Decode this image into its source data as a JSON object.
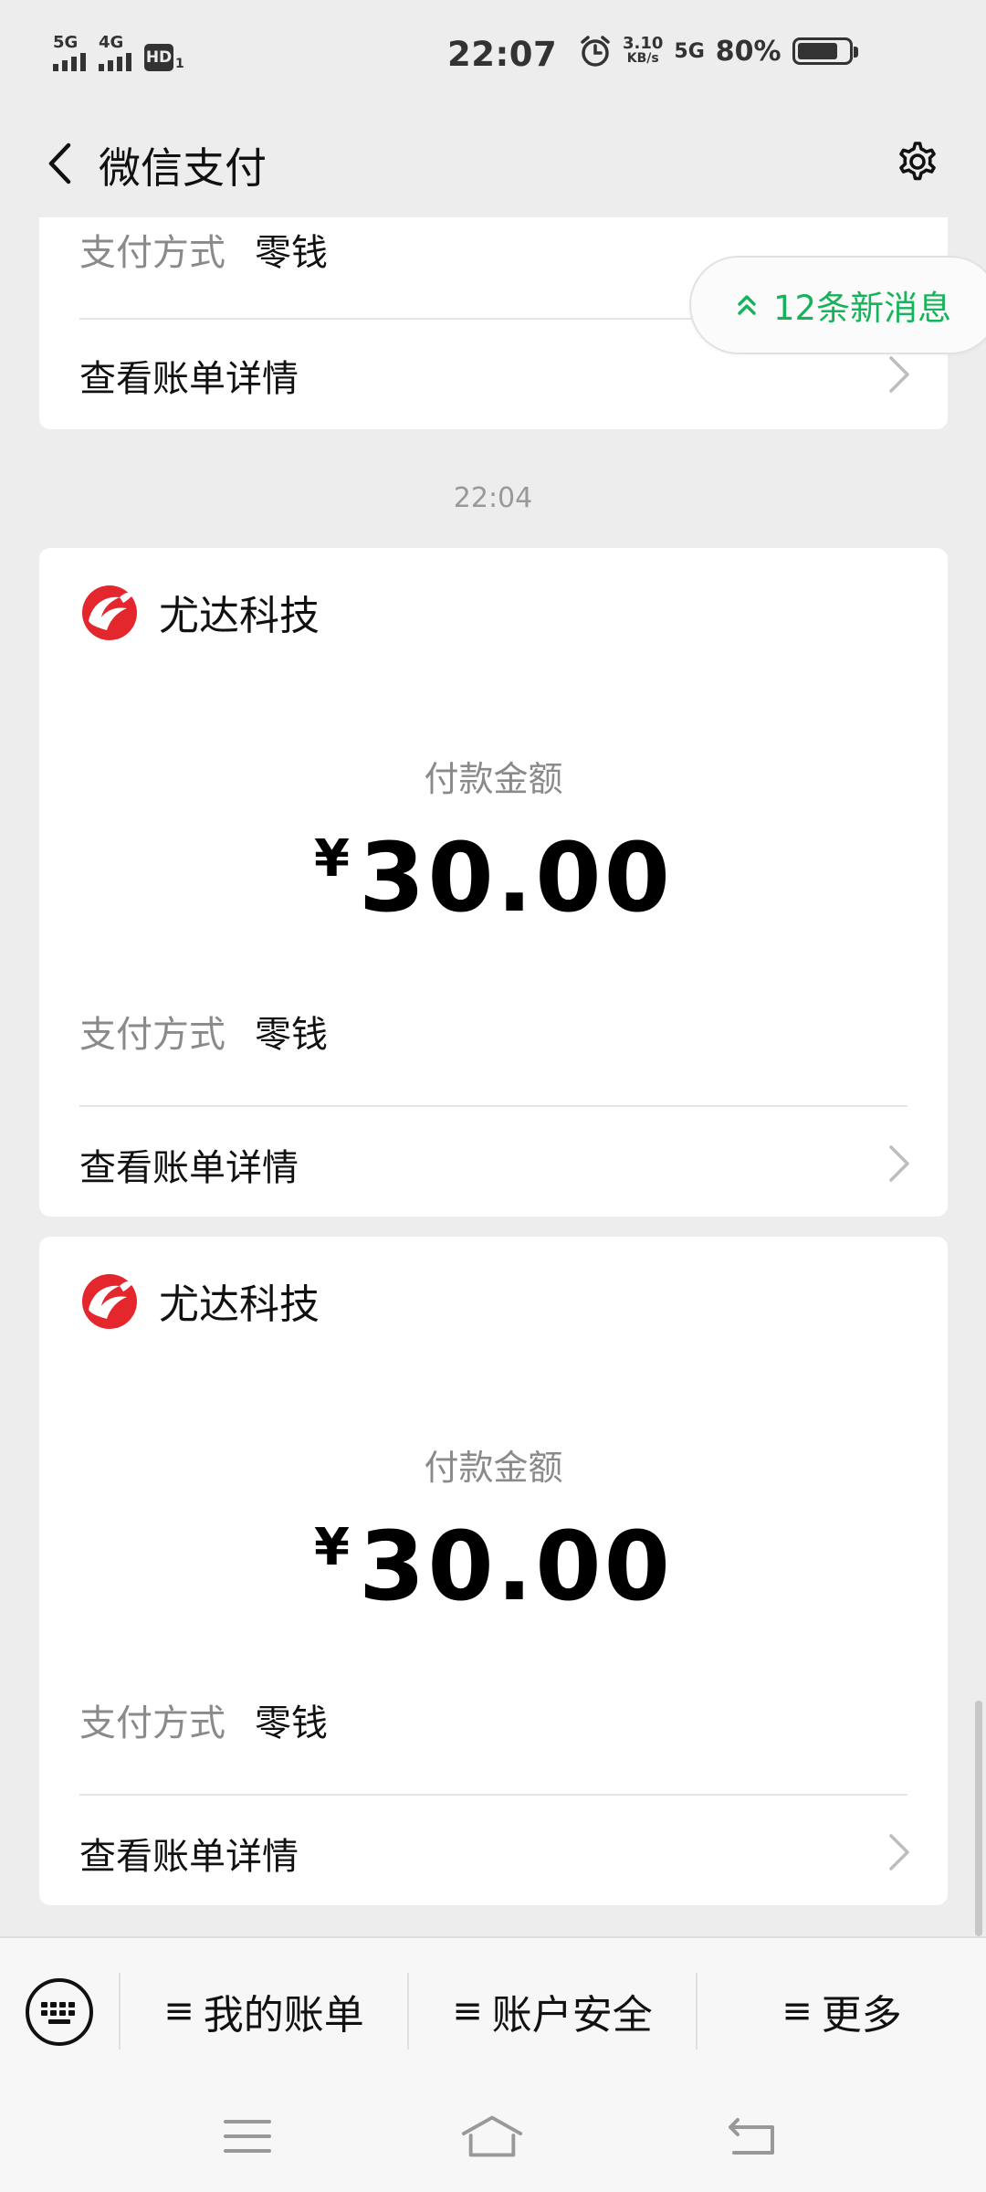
{
  "status_bar": {
    "sim1": "5G",
    "sim2": "4G",
    "hd_label": "HD",
    "hd_sub": "1",
    "time": "22:07",
    "speed_value": "3.10",
    "speed_unit": "KB/s",
    "net_type": "5G",
    "battery_pct": "80%",
    "battery_level": 0.8
  },
  "header": {
    "title": "微信支付"
  },
  "new_messages": {
    "label": "12条新消息"
  },
  "cards": [
    {
      "payment_method_label": "支付方式",
      "payment_method_value": "零钱",
      "view_details": "查看账单详情"
    },
    {
      "merchant": "尤达科技",
      "amount_label": "付款金额",
      "currency": "¥",
      "amount": "30.00",
      "payment_method_label": "支付方式",
      "payment_method_value": "零钱",
      "view_details": "查看账单详情"
    },
    {
      "merchant": "尤达科技",
      "amount_label": "付款金额",
      "currency": "¥",
      "amount": "30.00",
      "payment_method_label": "支付方式",
      "payment_method_value": "零钱",
      "view_details": "查看账单详情"
    }
  ],
  "timestamp": "22:04",
  "bottom_menu": {
    "items": [
      {
        "icon": "≡",
        "label": "我的账单"
      },
      {
        "icon": "≡",
        "label": "账户安全"
      },
      {
        "icon": "≡",
        "label": "更多"
      }
    ]
  },
  "colors": {
    "accent_green": "#16b35a",
    "merchant_logo_red": "#e4262d",
    "background": "#ededed"
  }
}
